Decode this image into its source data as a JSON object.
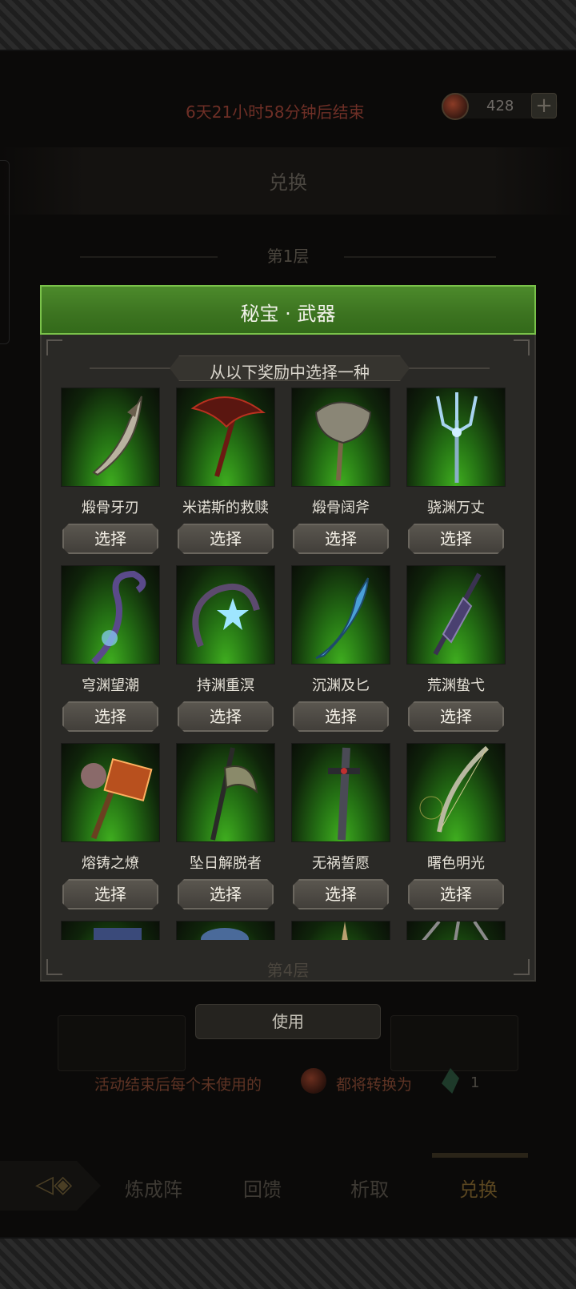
{
  "header": {
    "timer": "6天21小时58分钟后结束",
    "currency_amount": "428",
    "add_label": "+"
  },
  "exchange_banner": "兑换",
  "tiers": [
    "第1层",
    "第4层"
  ],
  "modal": {
    "title": "秘宝 · 武器",
    "subtitle": "从以下奖励中选择一种",
    "choose_label": "选择",
    "items": [
      {
        "name": "煅骨牙刃"
      },
      {
        "name": "米诺斯的救赎"
      },
      {
        "name": "煅骨阔斧"
      },
      {
        "name": "骁渊万丈"
      },
      {
        "name": "穹渊望潮"
      },
      {
        "name": "持渊重溟"
      },
      {
        "name": "沉渊及匕"
      },
      {
        "name": "荒渊蛰弋"
      },
      {
        "name": "熔铸之燎"
      },
      {
        "name": "坠日解脱者"
      },
      {
        "name": "无祸誓愿"
      },
      {
        "name": "曙色明光"
      }
    ]
  },
  "use_button": "使用",
  "notice": {
    "text_before": "活动结束后每个未使用的",
    "text_after": "都将转换为",
    "count": "1"
  },
  "tabs": [
    "炼成阵",
    "回馈",
    "析取",
    "兑换"
  ],
  "colors": {
    "modal_header_green": "#3c7320",
    "modal_header_border": "#7ac24a",
    "item_glow_green": "#3fae1f",
    "button_face": "#4e4a44"
  }
}
